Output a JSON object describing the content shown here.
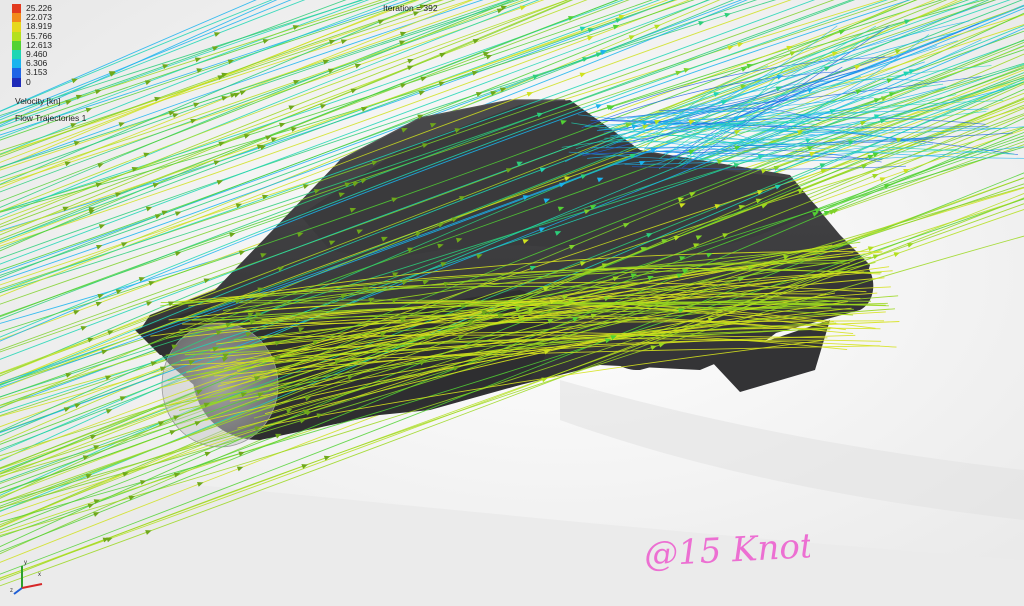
{
  "legend": {
    "entries": [
      {
        "value": "25.226",
        "color": "#e23a1e"
      },
      {
        "value": "22.073",
        "color": "#f28a1a"
      },
      {
        "value": "18.919",
        "color": "#e6d81c"
      },
      {
        "value": "15.766",
        "color": "#b4e01e"
      },
      {
        "value": "12.613",
        "color": "#52d234"
      },
      {
        "value": "9.460",
        "color": "#1ed6b4"
      },
      {
        "value": "6.306",
        "color": "#1ab4ee"
      },
      {
        "value": "3.153",
        "color": "#1e64e6"
      },
      {
        "value": "0",
        "color": "#1e2ab8"
      }
    ],
    "title": "Velocity [kn]",
    "subtitle": "Flow Trajectories 1"
  },
  "header": {
    "iteration": "Iteration = 392"
  },
  "annotation": {
    "handwritten": "@15 Knots",
    "color": "#ec6fd2"
  },
  "scene": {
    "hull_color": "#3c3c3e",
    "background_color": "#f4f4f4"
  },
  "triad": {
    "axes": [
      "x",
      "y",
      "z"
    ]
  }
}
